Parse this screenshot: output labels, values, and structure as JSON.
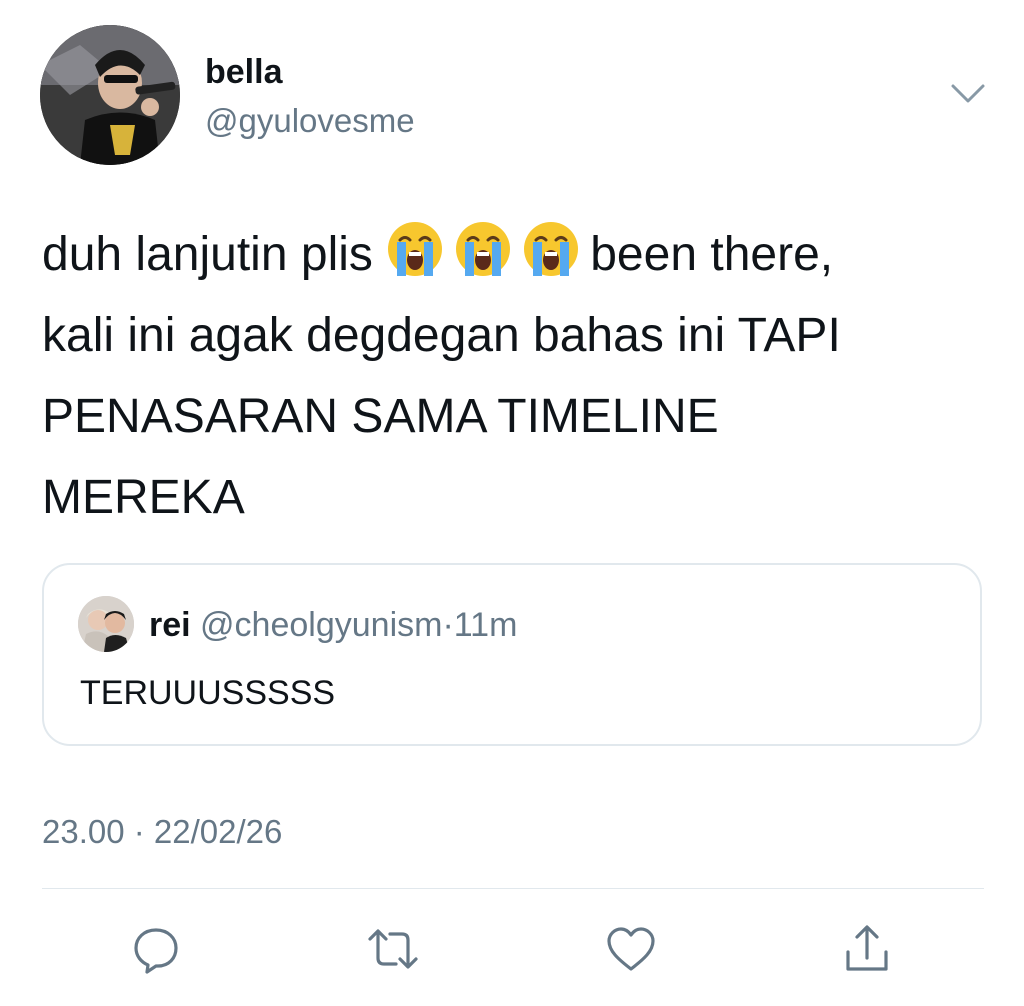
{
  "author": {
    "name": "bella",
    "handle": "@gyulovesme",
    "avatar_icon": "avatar-photo-singer-with-microphone"
  },
  "tweet": {
    "text_line1_before_emoji": "duh lanjutin plis",
    "emoji": [
      "loudly-crying-face",
      "loudly-crying-face",
      "loudly-crying-face"
    ],
    "text_line1_after_emoji": "been there,",
    "text_line2": "kali ini agak degdegan bahas ini TAPI",
    "text_line3": "PENASARAN SAMA TIMELINE",
    "text_line4": "MEREKA"
  },
  "quoted_tweet": {
    "name": "rei",
    "handle": "@cheolgyunism",
    "separator": "·",
    "time": "11m",
    "text": "TERUUUSSSSS",
    "avatar_icon": "avatar-photo-two-people"
  },
  "timestamp": "23.00 · 22/02/26",
  "actions": [
    "reply-icon",
    "retweet-icon",
    "like-icon",
    "share-icon"
  ],
  "colors": {
    "text": "#0f1419",
    "secondary": "#657786",
    "border": "#e1e8ed",
    "background": "#ffffff"
  }
}
